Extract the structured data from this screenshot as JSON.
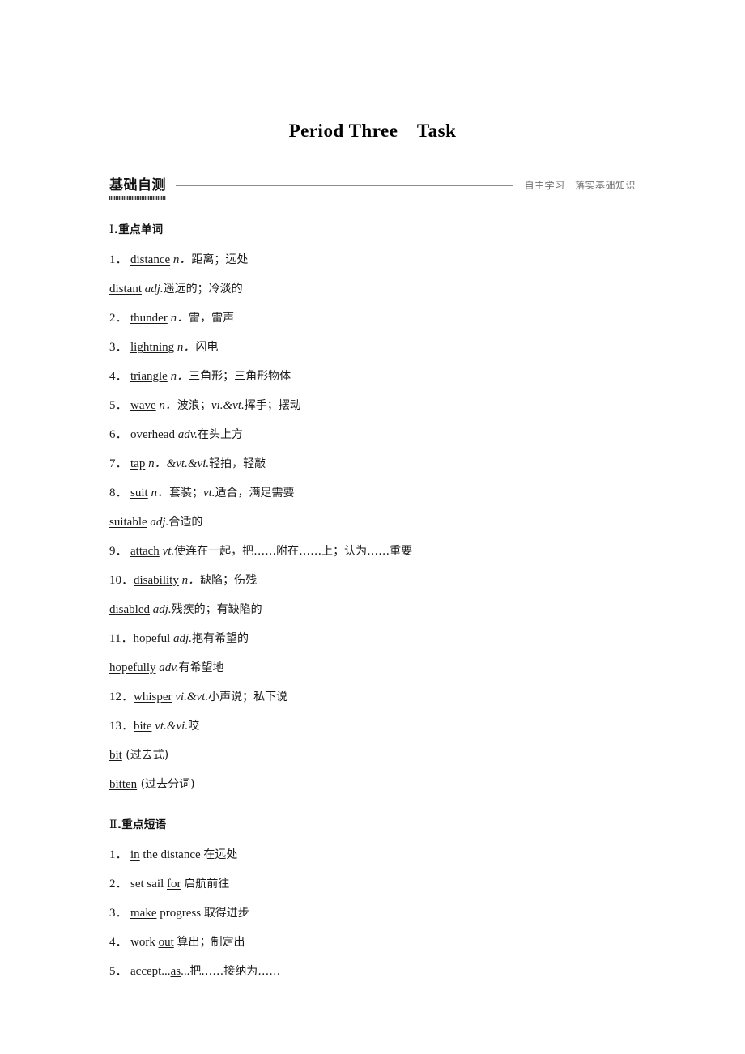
{
  "title": "Period Three　Task",
  "section": {
    "label": "基础自测",
    "right_note": "自主学习　落实基础知识"
  },
  "sections": [
    {
      "heading_roman": "Ⅰ",
      "heading_text": ".重点单词",
      "entries": [
        {
          "num": "1．",
          "word": "distance",
          "pos": "n．",
          "meaning": "距离；远处"
        },
        {
          "num": "",
          "word": "distant",
          "pos": "adj.",
          "meaning": "遥远的；冷淡的"
        },
        {
          "num": "2．",
          "word": "thunder",
          "pos": "n．",
          "meaning": "雷，雷声"
        },
        {
          "num": "3．",
          "word": "lightning",
          "pos": "n．",
          "meaning": "闪电"
        },
        {
          "num": "4．",
          "word": "triangle",
          "pos": "n．",
          "meaning": "三角形；三角形物体"
        },
        {
          "num": "5．",
          "word": "wave",
          "pos": "n．",
          "meaning": "波浪；",
          "pos2": "vi.&vt.",
          "meaning2": "挥手；摆动"
        },
        {
          "num": "6．",
          "word": "overhead",
          "pos": "adv.",
          "meaning": "在头上方"
        },
        {
          "num": "7．",
          "word": "tap",
          "pos": "n．",
          "meaning": "",
          "pos2": "&vt.&vi.",
          "meaning2": "轻拍，轻敲"
        },
        {
          "num": "8．",
          "word": "suit",
          "pos": "n．",
          "meaning": "套装；",
          "pos2": "vt.",
          "meaning2": "适合，满足需要"
        },
        {
          "num": "",
          "word": "suitable",
          "pos": "adj.",
          "meaning": "合适的"
        },
        {
          "num": "9．",
          "word": "attach",
          "pos": "vt.",
          "meaning": "使连在一起，把……附在……上；认为……重要"
        },
        {
          "num": "10．",
          "word": "disability",
          "pos": "n．",
          "meaning": "缺陷；伤残"
        },
        {
          "num": "",
          "word": "disabled",
          "pos": "adj.",
          "meaning": "残疾的；有缺陷的"
        },
        {
          "num": "11．",
          "word": "hopeful",
          "pos": "adj.",
          "meaning": "抱有希望的"
        },
        {
          "num": "",
          "word": "hopefully",
          "pos": "adv.",
          "meaning": "有希望地"
        },
        {
          "num": "12．",
          "word": "whisper",
          "pos": "vi.&vt.",
          "meaning": "小声说；私下说"
        },
        {
          "num": "13．",
          "word": "bite",
          "pos": "vt.&vi.",
          "meaning": "咬"
        },
        {
          "num": "",
          "word": "bit",
          "pos": "",
          "meaning": " (过去式)"
        },
        {
          "num": "",
          "word": "bitten",
          "pos": "",
          "meaning": " (过去分词)"
        }
      ]
    },
    {
      "heading_roman": "Ⅱ",
      "heading_text": ".重点短语",
      "phrases": [
        {
          "num": "1．",
          "pre": "",
          "u": "in",
          "post": " the distance ",
          "meaning": "在远处"
        },
        {
          "num": "2．",
          "pre": "set sail ",
          "u": "for",
          "post": " ",
          "meaning": "启航前往"
        },
        {
          "num": "3．",
          "pre": "",
          "u": "make",
          "post": " progress ",
          "meaning": "取得进步"
        },
        {
          "num": "4．",
          "pre": "work ",
          "u": "out",
          "post": " ",
          "meaning": "算出；制定出"
        },
        {
          "num": "5．",
          "pre": "accept...",
          "u": "as",
          "post": "...",
          "meaning": "把……接纳为……"
        }
      ]
    }
  ]
}
